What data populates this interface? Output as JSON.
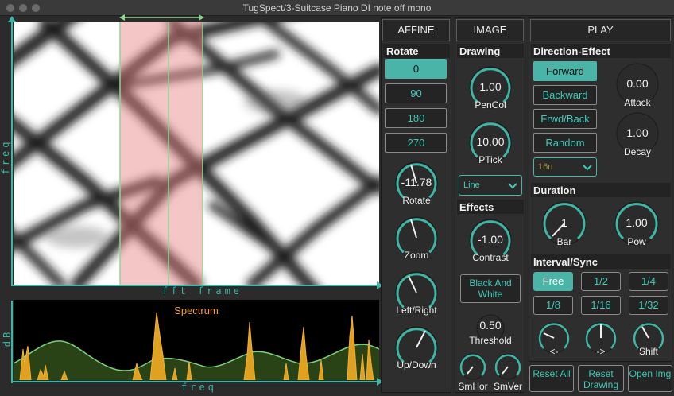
{
  "window": {
    "title": "TugSpect/3-Suitcase Piano DI note off mono"
  },
  "spectrogram": {
    "xlabel": "fft frame",
    "ylabel": "freq"
  },
  "spectrum": {
    "title": "Spectrum",
    "xlabel": "freq",
    "ylabel": "dB"
  },
  "colors": {
    "accent": "#4ab4a8",
    "selection": "#f3b0b0",
    "spectrum_fill": "#e0a020",
    "envelope": "#7ad07a"
  },
  "affine": {
    "title": "AFFINE",
    "section": "Rotate",
    "rotate_buttons": [
      "0",
      "90",
      "180",
      "270"
    ],
    "active_rotate": "0",
    "knobs": [
      {
        "label": "Rotate",
        "value": "-11.78"
      },
      {
        "label": "Zoom",
        "value": ""
      },
      {
        "label": "Left/Right",
        "value": ""
      },
      {
        "label": "Up/Down",
        "value": ""
      }
    ]
  },
  "image": {
    "title": "IMAGE",
    "drawing": {
      "section": "Drawing",
      "pencol": {
        "label": "PenCol",
        "value": "1.00"
      },
      "ptick": {
        "label": "PTick",
        "value": "10.00"
      },
      "mode": "Line"
    },
    "effects": {
      "section": "Effects",
      "contrast": {
        "label": "Contrast",
        "value": "-1.00"
      },
      "bw_button": "Black And White",
      "threshold": {
        "label": "Threshold",
        "value": "0.50"
      },
      "smhor": "SmHor",
      "smver": "SmVer"
    }
  },
  "play": {
    "title": "PLAY",
    "direction": {
      "section": "Direction-Effect",
      "buttons": [
        "Forward",
        "Backward",
        "Frwd/Back",
        "Random"
      ],
      "active": "Forward",
      "note_value": "16n",
      "attack": {
        "label": "Attack",
        "value": "0.00"
      },
      "decay": {
        "label": "Decay",
        "value": "1.00"
      }
    },
    "duration": {
      "section": "Duration",
      "bar": {
        "label": "Bar",
        "value": "1"
      },
      "pow": {
        "label": "Pow",
        "value": "1.00"
      }
    },
    "interval": {
      "section": "Interval/Sync",
      "buttons": [
        "Free",
        "1/2",
        "1/4",
        "1/8",
        "1/16",
        "1/32"
      ],
      "active": "Free",
      "knobs": [
        "<-",
        "->",
        "Shift"
      ]
    },
    "bottom_buttons": [
      "Reset All",
      "Reset Drawing",
      "Open Img"
    ]
  }
}
